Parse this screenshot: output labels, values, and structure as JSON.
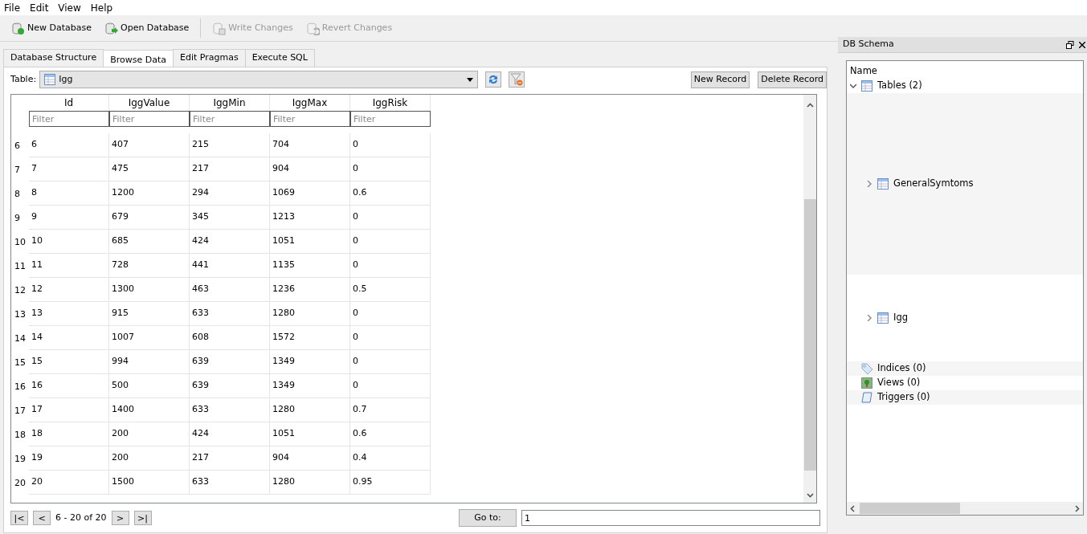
{
  "menu": [
    "File",
    "Edit",
    "View",
    "Help"
  ],
  "toolbar": [
    {
      "label": "New Database",
      "kind": "new",
      "disabled": false
    },
    {
      "label": "Open Database",
      "kind": "open",
      "disabled": false
    },
    {
      "label": "Write Changes",
      "kind": "write",
      "disabled": true
    },
    {
      "label": "Revert Changes",
      "kind": "revert",
      "disabled": true
    }
  ],
  "tabs": [
    {
      "label": "Database Structure",
      "selected": false
    },
    {
      "label": "Browse Data",
      "selected": true
    },
    {
      "label": "Edit Pragmas",
      "selected": false
    },
    {
      "label": "Execute SQL",
      "selected": false
    }
  ],
  "table_selector": {
    "label": "Table:",
    "value": "Igg"
  },
  "buttons": [
    "New Record",
    "Delete Record"
  ],
  "grid": {
    "columns": [
      {
        "name": "Id",
        "placeholder": "Filter"
      },
      {
        "name": "IggValue",
        "placeholder": "Filter"
      },
      {
        "name": "IggMin",
        "placeholder": "Filter"
      },
      {
        "name": "IggMax",
        "placeholder": "Filter"
      },
      {
        "name": "IggRisk",
        "placeholder": "Filter"
      }
    ],
    "rows": [
      {
        "header": "6",
        "cells": [
          "6",
          "407",
          "215",
          "704",
          "0"
        ]
      },
      {
        "header": "7",
        "cells": [
          "7",
          "475",
          "217",
          "904",
          "0"
        ]
      },
      {
        "header": "8",
        "cells": [
          "8",
          "1200",
          "294",
          "1069",
          "0.6"
        ]
      },
      {
        "header": "9",
        "cells": [
          "9",
          "679",
          "345",
          "1213",
          "0"
        ]
      },
      {
        "header": "10",
        "cells": [
          "10",
          "685",
          "424",
          "1051",
          "0"
        ]
      },
      {
        "header": "11",
        "cells": [
          "11",
          "728",
          "441",
          "1135",
          "0"
        ]
      },
      {
        "header": "12",
        "cells": [
          "12",
          "1300",
          "463",
          "1236",
          "0.5"
        ]
      },
      {
        "header": "13",
        "cells": [
          "13",
          "915",
          "633",
          "1280",
          "0"
        ]
      },
      {
        "header": "14",
        "cells": [
          "14",
          "1007",
          "608",
          "1572",
          "0"
        ]
      },
      {
        "header": "15",
        "cells": [
          "15",
          "994",
          "639",
          "1349",
          "0"
        ]
      },
      {
        "header": "16",
        "cells": [
          "16",
          "500",
          "639",
          "1349",
          "0"
        ]
      },
      {
        "header": "17",
        "cells": [
          "17",
          "1400",
          "633",
          "1280",
          "0.7"
        ]
      },
      {
        "header": "18",
        "cells": [
          "18",
          "200",
          "424",
          "1051",
          "0.6"
        ]
      },
      {
        "header": "19",
        "cells": [
          "19",
          "200",
          "217",
          "904",
          "0.4"
        ]
      },
      {
        "header": "20",
        "cells": [
          "20",
          "1500",
          "633",
          "1280",
          "0.95"
        ]
      }
    ]
  },
  "pager": {
    "back": [
      "|<",
      "<"
    ],
    "status": "6 - 20 of 20",
    "forward": [
      ">",
      ">|"
    ],
    "goto_label": "Go to:",
    "goto_value": "1"
  },
  "dock": {
    "title": "DB Schema",
    "tree_header": "Name",
    "items": [
      {
        "label": "Tables (2)",
        "kind": "tables",
        "expanded": true,
        "children": [
          {
            "label": "GeneralSymtoms",
            "kind": "table",
            "expanded": false
          },
          {
            "label": "Igg",
            "kind": "table",
            "expanded": false
          }
        ]
      },
      {
        "label": "Indices (0)",
        "kind": "indices"
      },
      {
        "label": "Views (0)",
        "kind": "views"
      },
      {
        "label": "Triggers (0)",
        "kind": "triggers"
      }
    ]
  }
}
